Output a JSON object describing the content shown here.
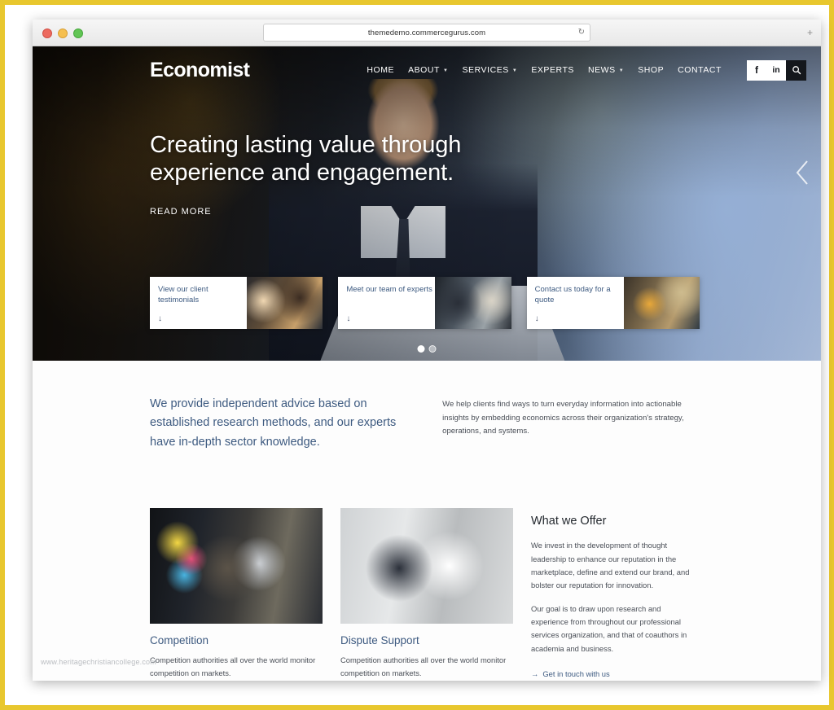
{
  "browser": {
    "url": "themedemo.commercegurus.com",
    "reload_glyph": "↻",
    "new_tab_glyph": "+"
  },
  "header": {
    "logo": "Economist",
    "nav": [
      {
        "label": "HOME",
        "has_caret": false
      },
      {
        "label": "ABOUT",
        "has_caret": true
      },
      {
        "label": "SERVICES",
        "has_caret": true
      },
      {
        "label": "EXPERTS",
        "has_caret": false
      },
      {
        "label": "NEWS",
        "has_caret": true
      },
      {
        "label": "SHOP",
        "has_caret": false
      },
      {
        "label": "CONTACT",
        "has_caret": false
      }
    ],
    "social": {
      "facebook": "f",
      "linkedin": "in"
    }
  },
  "hero": {
    "title": "Creating lasting value through experience and engagement.",
    "cta": "READ MORE",
    "cards": [
      {
        "label": "View our client testimonials",
        "arrow": "↓"
      },
      {
        "label": "Meet our team of experts",
        "arrow": "↓"
      },
      {
        "label": "Contact us today for a quote",
        "arrow": "↓"
      }
    ],
    "slide_count": 2,
    "active_slide": 1
  },
  "intro": {
    "lead": "We provide independent advice based on established research methods, and our experts have in-depth sector knowledge.",
    "body": "We help clients find ways to turn everyday information into actionable insights by embedding economics across their organization's strategy, operations, and systems."
  },
  "offer": {
    "cards": [
      {
        "title": "Competition",
        "desc": "Competition authorities all over the world monitor competition on markets."
      },
      {
        "title": "Dispute Support",
        "desc": "Competition authorities all over the world monitor competition on markets."
      }
    ],
    "heading": "What we Offer",
    "paragraphs": [
      "We invest in the development of thought leadership to enhance our reputation in the marketplace, define and extend our brand, and bolster our reputation for innovation.",
      "Our goal is to draw upon research and experience from throughout our professional services organization, and that of coauthors in academia and business."
    ],
    "link": "Get in touch with us",
    "link_arrow": "→"
  },
  "watermark": "www.heritagechristiancollege.com",
  "colors": {
    "frame": "#e8c72e",
    "accent_blue": "#3d5a80",
    "body_text": "#4a4f57",
    "header_dark": "#14171c"
  }
}
